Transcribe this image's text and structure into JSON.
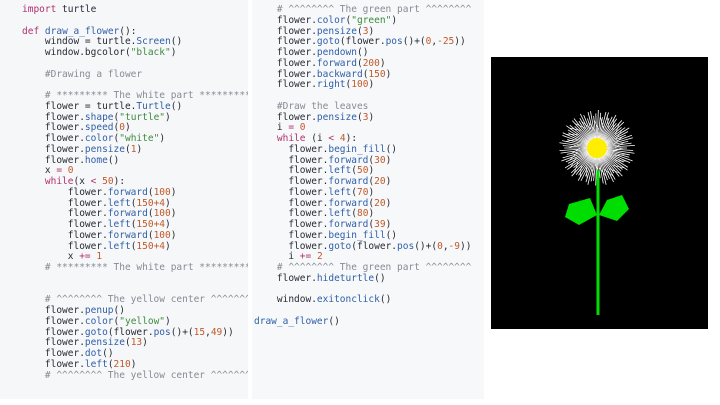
{
  "code_left": [
    [
      [
        "kw",
        "import"
      ],
      [
        "plain",
        " turtle"
      ]
    ],
    [],
    [
      [
        "kw",
        "def"
      ],
      [
        "plain",
        " "
      ],
      [
        "fn",
        "draw_a_flower"
      ],
      [
        "plain",
        "():"
      ]
    ],
    [
      [
        "plain",
        "    window = turtle."
      ],
      [
        "fn",
        "Screen"
      ],
      [
        "plain",
        "()"
      ]
    ],
    [
      [
        "plain",
        "    window.bgcolor("
      ],
      [
        "str",
        "\"black\""
      ],
      [
        "plain",
        ")"
      ]
    ],
    [],
    [
      [
        "cmt",
        "    #Drawing a flower"
      ]
    ],
    [],
    [
      [
        "cmt",
        "    # ********* The white part *********"
      ]
    ],
    [
      [
        "plain",
        "    flower = turtle."
      ],
      [
        "fn",
        "Turtle"
      ],
      [
        "plain",
        "()"
      ]
    ],
    [
      [
        "plain",
        "    flower."
      ],
      [
        "fn",
        "shape"
      ],
      [
        "plain",
        "("
      ],
      [
        "str",
        "\"turtle\""
      ],
      [
        "plain",
        ")"
      ]
    ],
    [
      [
        "plain",
        "    flower."
      ],
      [
        "fn",
        "speed"
      ],
      [
        "plain",
        "("
      ],
      [
        "num",
        "0"
      ],
      [
        "plain",
        ")"
      ]
    ],
    [
      [
        "plain",
        "    flower."
      ],
      [
        "fn",
        "color"
      ],
      [
        "plain",
        "("
      ],
      [
        "str",
        "\"white\""
      ],
      [
        "plain",
        ")"
      ]
    ],
    [
      [
        "plain",
        "    flower."
      ],
      [
        "fn",
        "pensize"
      ],
      [
        "plain",
        "("
      ],
      [
        "num",
        "1"
      ],
      [
        "plain",
        ")"
      ]
    ],
    [
      [
        "plain",
        "    flower."
      ],
      [
        "fn",
        "home"
      ],
      [
        "plain",
        "()"
      ]
    ],
    [
      [
        "plain",
        "    x "
      ],
      [
        "op",
        "="
      ],
      [
        "plain",
        " "
      ],
      [
        "num",
        "0"
      ]
    ],
    [
      [
        "plain",
        "    "
      ],
      [
        "kw",
        "while"
      ],
      [
        "plain",
        "(x "
      ],
      [
        "op",
        "<"
      ],
      [
        "plain",
        " "
      ],
      [
        "num",
        "50"
      ],
      [
        "plain",
        "):"
      ]
    ],
    [
      [
        "plain",
        "        flower."
      ],
      [
        "fn",
        "forward"
      ],
      [
        "plain",
        "("
      ],
      [
        "num",
        "100"
      ],
      [
        "plain",
        ")"
      ]
    ],
    [
      [
        "plain",
        "        flower."
      ],
      [
        "fn",
        "left"
      ],
      [
        "plain",
        "("
      ],
      [
        "num",
        "150+4"
      ],
      [
        "plain",
        ")"
      ]
    ],
    [
      [
        "plain",
        "        flower."
      ],
      [
        "fn",
        "forward"
      ],
      [
        "plain",
        "("
      ],
      [
        "num",
        "100"
      ],
      [
        "plain",
        ")"
      ]
    ],
    [
      [
        "plain",
        "        flower."
      ],
      [
        "fn",
        "left"
      ],
      [
        "plain",
        "("
      ],
      [
        "num",
        "150+4"
      ],
      [
        "plain",
        ")"
      ]
    ],
    [
      [
        "plain",
        "        flower."
      ],
      [
        "fn",
        "forward"
      ],
      [
        "plain",
        "("
      ],
      [
        "num",
        "100"
      ],
      [
        "plain",
        ")"
      ]
    ],
    [
      [
        "plain",
        "        flower."
      ],
      [
        "fn",
        "left"
      ],
      [
        "plain",
        "("
      ],
      [
        "num",
        "150+4"
      ],
      [
        "plain",
        ")"
      ]
    ],
    [
      [
        "plain",
        "        x "
      ],
      [
        "op",
        "+="
      ],
      [
        "plain",
        " "
      ],
      [
        "num",
        "1"
      ]
    ],
    [
      [
        "cmt",
        "    # ********* The white part *********"
      ]
    ],
    [],
    [],
    [
      [
        "cmt",
        "    # ^^^^^^^^ The yellow center ^^^^^^^^"
      ]
    ],
    [
      [
        "plain",
        "    flower."
      ],
      [
        "fn",
        "penup"
      ],
      [
        "plain",
        "()"
      ]
    ],
    [
      [
        "plain",
        "    flower."
      ],
      [
        "fn",
        "color"
      ],
      [
        "plain",
        "("
      ],
      [
        "str",
        "\"yellow\""
      ],
      [
        "plain",
        ")"
      ]
    ],
    [
      [
        "plain",
        "    flower."
      ],
      [
        "fn",
        "goto"
      ],
      [
        "plain",
        "(flower."
      ],
      [
        "fn",
        "pos"
      ],
      [
        "plain",
        "()+("
      ],
      [
        "num",
        "15"
      ],
      [
        "plain",
        ","
      ],
      [
        "num",
        "49"
      ],
      [
        "plain",
        "))"
      ]
    ],
    [
      [
        "plain",
        "    flower."
      ],
      [
        "fn",
        "pensize"
      ],
      [
        "plain",
        "("
      ],
      [
        "num",
        "13"
      ],
      [
        "plain",
        ")"
      ]
    ],
    [
      [
        "plain",
        "    flower."
      ],
      [
        "fn",
        "dot"
      ],
      [
        "plain",
        "()"
      ]
    ],
    [
      [
        "plain",
        "    flower."
      ],
      [
        "fn",
        "left"
      ],
      [
        "plain",
        "("
      ],
      [
        "num",
        "210"
      ],
      [
        "plain",
        ")"
      ]
    ],
    [
      [
        "cmt",
        "    # ^^^^^^^^ The yellow center ^^^^^^^^"
      ]
    ]
  ],
  "code_middle": [
    [
      [
        "cmt",
        "    # ^^^^^^^^ The green part ^^^^^^^^"
      ]
    ],
    [
      [
        "plain",
        "    flower."
      ],
      [
        "fn",
        "color"
      ],
      [
        "plain",
        "("
      ],
      [
        "str",
        "\"green\""
      ],
      [
        "plain",
        ")"
      ]
    ],
    [
      [
        "plain",
        "    flower."
      ],
      [
        "fn",
        "pensize"
      ],
      [
        "plain",
        "("
      ],
      [
        "num",
        "3"
      ],
      [
        "plain",
        ")"
      ]
    ],
    [
      [
        "plain",
        "    flower."
      ],
      [
        "fn",
        "goto"
      ],
      [
        "plain",
        "(flower."
      ],
      [
        "fn",
        "pos"
      ],
      [
        "plain",
        "()+("
      ],
      [
        "num",
        "0"
      ],
      [
        "plain",
        ","
      ],
      [
        "num",
        "-25"
      ],
      [
        "plain",
        "))"
      ]
    ],
    [
      [
        "plain",
        "    flower."
      ],
      [
        "fn",
        "pendown"
      ],
      [
        "plain",
        "()"
      ]
    ],
    [
      [
        "plain",
        "    flower."
      ],
      [
        "fn",
        "forward"
      ],
      [
        "plain",
        "("
      ],
      [
        "num",
        "200"
      ],
      [
        "plain",
        ")"
      ]
    ],
    [
      [
        "plain",
        "    flower."
      ],
      [
        "fn",
        "backward"
      ],
      [
        "plain",
        "("
      ],
      [
        "num",
        "150"
      ],
      [
        "plain",
        ")"
      ]
    ],
    [
      [
        "plain",
        "    flower."
      ],
      [
        "fn",
        "right"
      ],
      [
        "plain",
        "("
      ],
      [
        "num",
        "100"
      ],
      [
        "plain",
        ")"
      ]
    ],
    [],
    [
      [
        "cmt",
        "    #Draw the leaves"
      ]
    ],
    [
      [
        "plain",
        "    flower."
      ],
      [
        "fn",
        "pensize"
      ],
      [
        "plain",
        "("
      ],
      [
        "num",
        "3"
      ],
      [
        "plain",
        ")"
      ]
    ],
    [
      [
        "plain",
        "    i "
      ],
      [
        "op",
        "="
      ],
      [
        "plain",
        " "
      ],
      [
        "num",
        "0"
      ]
    ],
    [
      [
        "plain",
        "    "
      ],
      [
        "kw",
        "while"
      ],
      [
        "plain",
        " (i "
      ],
      [
        "op",
        "<"
      ],
      [
        "plain",
        " "
      ],
      [
        "num",
        "4"
      ],
      [
        "plain",
        "):"
      ]
    ],
    [
      [
        "plain",
        "      flower."
      ],
      [
        "fn",
        "begin_fill"
      ],
      [
        "plain",
        "()"
      ]
    ],
    [
      [
        "plain",
        "      flower."
      ],
      [
        "fn",
        "forward"
      ],
      [
        "plain",
        "("
      ],
      [
        "num",
        "30"
      ],
      [
        "plain",
        ")"
      ]
    ],
    [
      [
        "plain",
        "      flower."
      ],
      [
        "fn",
        "left"
      ],
      [
        "plain",
        "("
      ],
      [
        "num",
        "50"
      ],
      [
        "plain",
        ")"
      ]
    ],
    [
      [
        "plain",
        "      flower."
      ],
      [
        "fn",
        "forward"
      ],
      [
        "plain",
        "("
      ],
      [
        "num",
        "20"
      ],
      [
        "plain",
        ")"
      ]
    ],
    [
      [
        "plain",
        "      flower."
      ],
      [
        "fn",
        "left"
      ],
      [
        "plain",
        "("
      ],
      [
        "num",
        "70"
      ],
      [
        "plain",
        ")"
      ]
    ],
    [
      [
        "plain",
        "      flower."
      ],
      [
        "fn",
        "forward"
      ],
      [
        "plain",
        "("
      ],
      [
        "num",
        "20"
      ],
      [
        "plain",
        ")"
      ]
    ],
    [
      [
        "plain",
        "      flower."
      ],
      [
        "fn",
        "left"
      ],
      [
        "plain",
        "("
      ],
      [
        "num",
        "80"
      ],
      [
        "plain",
        ")"
      ]
    ],
    [
      [
        "plain",
        "      flower."
      ],
      [
        "fn",
        "forward"
      ],
      [
        "plain",
        "("
      ],
      [
        "num",
        "39"
      ],
      [
        "plain",
        ")"
      ]
    ],
    [
      [
        "plain",
        "      flower."
      ],
      [
        "fn",
        "begin_fill"
      ],
      [
        "plain",
        "()"
      ]
    ],
    [
      [
        "plain",
        "      flower."
      ],
      [
        "fn",
        "goto"
      ],
      [
        "plain",
        "(flower."
      ],
      [
        "fn",
        "pos"
      ],
      [
        "plain",
        "()+("
      ],
      [
        "num",
        "0"
      ],
      [
        "plain",
        ","
      ],
      [
        "num",
        "-9"
      ],
      [
        "plain",
        "))"
      ]
    ],
    [
      [
        "plain",
        "      i "
      ],
      [
        "op",
        "+="
      ],
      [
        "plain",
        " "
      ],
      [
        "num",
        "2"
      ]
    ],
    [
      [
        "cmt",
        "    # ^^^^^^^^ The green part ^^^^^^^^"
      ]
    ],
    [
      [
        "plain",
        "    flower."
      ],
      [
        "fn",
        "hideturtle"
      ],
      [
        "plain",
        "()"
      ]
    ],
    [],
    [
      [
        "plain",
        "    window."
      ],
      [
        "fn",
        "exitonclick"
      ],
      [
        "plain",
        "()"
      ]
    ],
    [],
    [
      [
        "plain",
        ""
      ],
      [
        "fn",
        "draw_a_flower"
      ],
      [
        "plain",
        "()"
      ]
    ]
  ],
  "canvas": {
    "background": "#000000",
    "petal_color": "#ffffff",
    "center_color": "#ffee00",
    "stem_color": "#00dd00",
    "leaf_color": "#00dd00",
    "icons": [
      "turtle-drawing"
    ]
  },
  "colors": {
    "keyword": "#b0306e",
    "function": "#2f5fa7",
    "string": "#3c8b3c",
    "number": "#c05a2a",
    "comment": "#858c96",
    "plain": "#262a33"
  }
}
